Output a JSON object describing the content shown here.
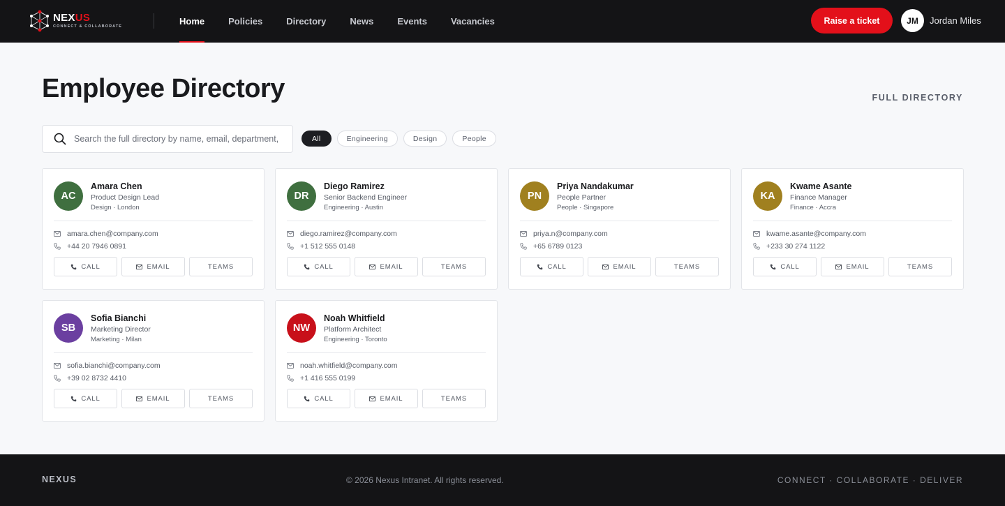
{
  "header": {
    "brand": {
      "part1": "NEX",
      "part2": "US",
      "tagline": "CONNECT & COLLABORATE"
    },
    "nav": [
      {
        "label": "Home",
        "active": true
      },
      {
        "label": "Policies",
        "active": false
      },
      {
        "label": "Directory",
        "active": false
      },
      {
        "label": "News",
        "active": false
      },
      {
        "label": "Events",
        "active": false
      },
      {
        "label": "Vacancies",
        "active": false
      }
    ],
    "ticket_button": "Raise a ticket",
    "user": {
      "initials": "JM",
      "name": "Jordan Miles"
    }
  },
  "main": {
    "title": "Employee Directory",
    "full_directory_link": "FULL DIRECTORY",
    "search_placeholder": "Search the full directory by name, email, department, position...",
    "filters": [
      {
        "label": "All",
        "active": true
      },
      {
        "label": "Engineering",
        "active": false
      },
      {
        "label": "Design",
        "active": false
      },
      {
        "label": "People",
        "active": false
      }
    ],
    "actions": {
      "call": "CALL",
      "email": "EMAIL",
      "teams": "TEAMS"
    },
    "employees": [
      {
        "initials": "AC",
        "name": "Amara Chen",
        "role": "Product Design Lead",
        "meta": "Design · London",
        "email": "amara.chen@company.com",
        "phone": "+44 20 7946 0891",
        "color": "#3f6f3f"
      },
      {
        "initials": "DR",
        "name": "Diego Ramirez",
        "role": "Senior Backend Engineer",
        "meta": "Engineering · Austin",
        "email": "diego.ramirez@company.com",
        "phone": "+1 512 555 0148",
        "color": "#3f6f3f"
      },
      {
        "initials": "PN",
        "name": "Priya Nandakumar",
        "role": "People Partner",
        "meta": "People · Singapore",
        "email": "priya.n@company.com",
        "phone": "+65 6789 0123",
        "color": "#a0801f"
      },
      {
        "initials": "KA",
        "name": "Kwame Asante",
        "role": "Finance Manager",
        "meta": "Finance · Accra",
        "email": "kwame.asante@company.com",
        "phone": "+233 30 274 1122",
        "color": "#a0801f"
      },
      {
        "initials": "SB",
        "name": "Sofia Bianchi",
        "role": "Marketing Director",
        "meta": "Marketing · Milan",
        "email": "sofia.bianchi@company.com",
        "phone": "+39 02 8732 4410",
        "color": "#6b3fa0"
      },
      {
        "initials": "NW",
        "name": "Noah Whitfield",
        "role": "Platform Architect",
        "meta": "Engineering · Toronto",
        "email": "noah.whitfield@company.com",
        "phone": "+1 416 555 0199",
        "color": "#c8101a"
      }
    ]
  },
  "footer": {
    "brand": "NEXUS",
    "copyright": "© 2026 Nexus Intranet. All rights reserved.",
    "tagline": "CONNECT · COLLABORATE · DELIVER"
  },
  "colors": {
    "accent": "#e3101a",
    "header_bg": "#141416",
    "page_bg": "#f7f8fa"
  }
}
